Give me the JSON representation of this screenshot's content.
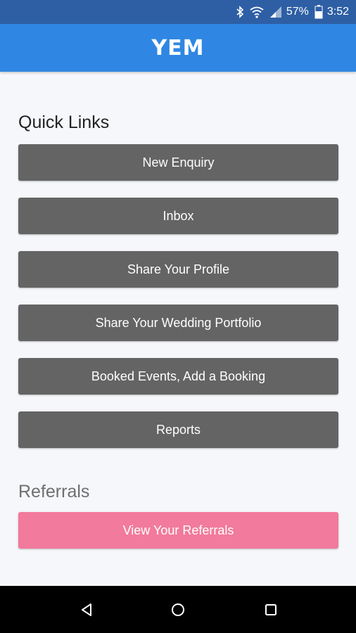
{
  "status_bar": {
    "battery_percent": "57%",
    "time": "3:52"
  },
  "app_bar": {
    "title": "YEM"
  },
  "quick_links": {
    "heading": "Quick Links",
    "items": [
      {
        "label": "New Enquiry"
      },
      {
        "label": "Inbox"
      },
      {
        "label": "Share Your Profile"
      },
      {
        "label": "Share Your Wedding Portfolio"
      },
      {
        "label": "Booked Events, Add a Booking"
      },
      {
        "label": "Reports"
      }
    ]
  },
  "referrals": {
    "heading": "Referrals",
    "button_label": "View Your Referrals"
  },
  "nav_bar": {
    "icons": [
      "back-icon",
      "home-icon",
      "recents-icon"
    ]
  },
  "colors": {
    "status_bar": "#2e5fa5",
    "app_bar": "#2f87e3",
    "button_gray": "#646464",
    "button_pink": "#f27a9c",
    "background": "#f5f7fa"
  }
}
